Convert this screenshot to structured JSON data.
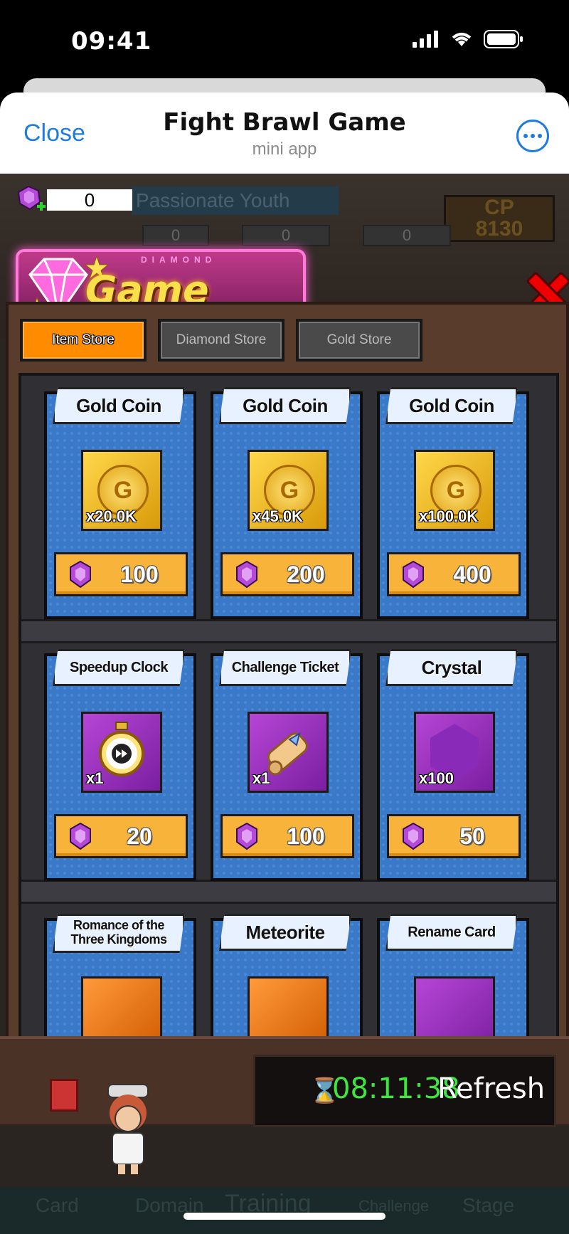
{
  "status_bar": {
    "time": "09:41"
  },
  "header": {
    "close_label": "Close",
    "title": "Fight Brawl Game",
    "subtitle": "mini app"
  },
  "hud": {
    "gem_count": "0",
    "player_name": "Passionate Youth",
    "cp_label": "CP",
    "cp_value": "8130",
    "resources": [
      "0",
      "0",
      "0"
    ]
  },
  "store": {
    "logo_sub": "DIAMOND",
    "logo_title": "Game Store",
    "tabs": [
      {
        "label": "Item Store",
        "active": true
      },
      {
        "label": "Diamond Store",
        "active": false
      },
      {
        "label": "Gold Store",
        "active": false
      }
    ],
    "items": [
      {
        "name": "Gold Coin",
        "qty": "x20.0K",
        "price": "100",
        "icon": "gold-coin-icon",
        "style": "gold"
      },
      {
        "name": "Gold Coin",
        "qty": "x45.0K",
        "price": "200",
        "icon": "gold-coin-icon",
        "style": "gold"
      },
      {
        "name": "Gold Coin",
        "qty": "x100.0K",
        "price": "400",
        "icon": "gold-coin-icon",
        "style": "gold"
      },
      {
        "name": "Speedup Clock",
        "qty": "x1",
        "price": "20",
        "icon": "stopwatch-icon",
        "style": "purple"
      },
      {
        "name": "Challenge Ticket",
        "qty": "x1",
        "price": "100",
        "icon": "scroll-icon",
        "style": "purple"
      },
      {
        "name": "Crystal",
        "qty": "x100",
        "price": "50",
        "icon": "crystal-icon",
        "style": "purple"
      },
      {
        "name_line1": "Romance of the",
        "name_line2": "Three Kingdoms",
        "icon": "book-icon",
        "style": "orange"
      },
      {
        "name": "Meteorite",
        "icon": "meteorite-icon",
        "style": "orange"
      },
      {
        "name": "Rename Card",
        "icon": "rename-card-icon",
        "style": "purple"
      }
    ],
    "timer": "08:11:38",
    "refresh_label": "Refresh"
  },
  "bottom_nav": [
    "Card",
    "Domain",
    "Training",
    "Challenge",
    "Stage"
  ],
  "colors": {
    "accent": "#1e7be0",
    "tab_active": "#ff8c00",
    "timer": "#3ee63e",
    "price_button": "#f8b43a"
  }
}
